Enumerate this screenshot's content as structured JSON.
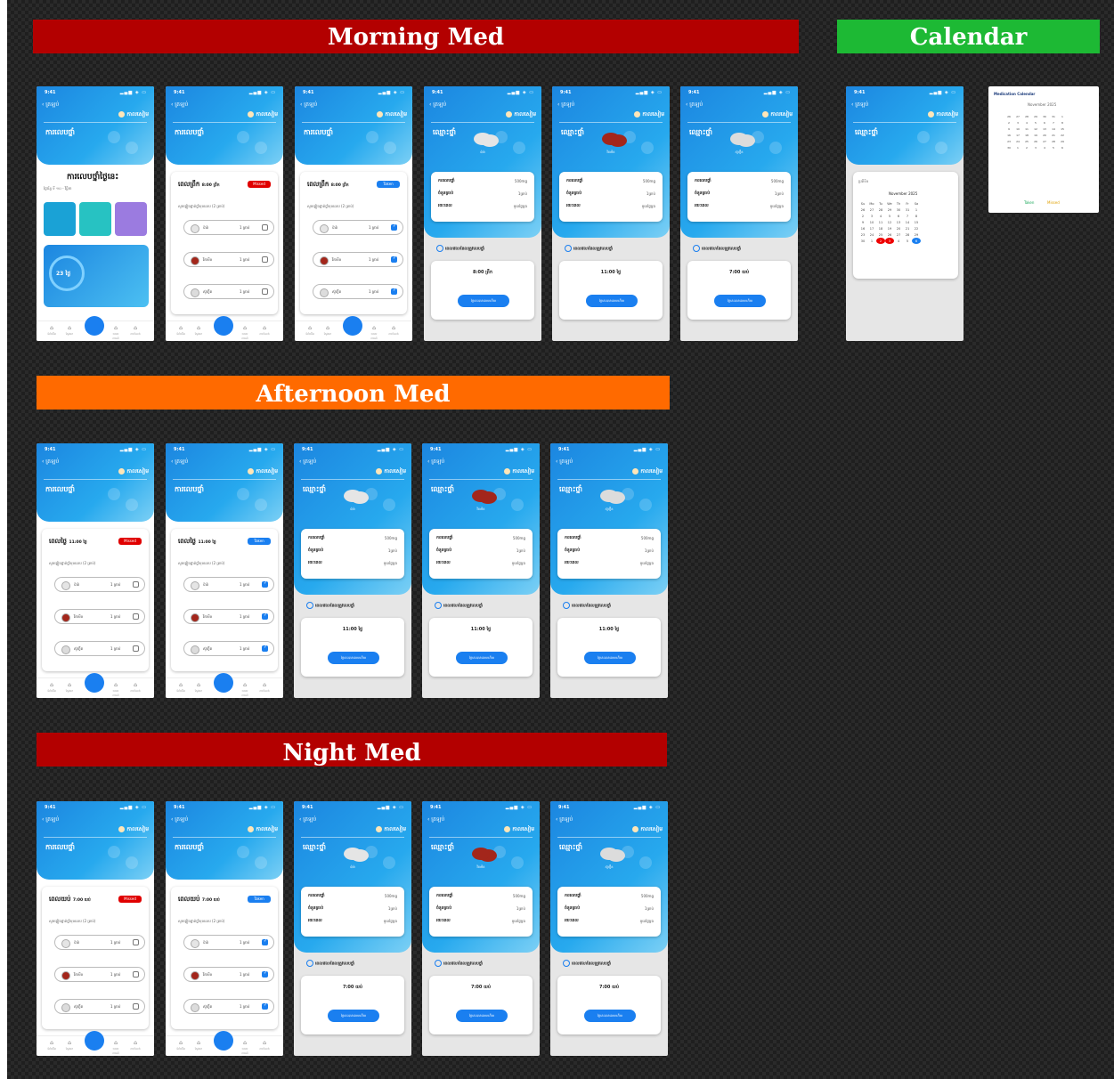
{
  "sections": {
    "morning": "Morning Med",
    "afternoon": "Afternoon Med",
    "night": "Night Med",
    "calendar": "Calendar"
  },
  "colors": {
    "morning": "#b30000",
    "afternoon": "#ff6a00",
    "night": "#b30000",
    "calendar": "#1db934",
    "accent": "#1a7ff0"
  },
  "phone": {
    "time": "9:41",
    "signal": "▂▄▆ ◈ ▭",
    "back": "‹ ត្រឡប់",
    "user": "កាលសៀម",
    "title_list": "ការលេបថ្នាំ",
    "title_detail": "ឈ្មោះថ្នាំ"
  },
  "morning": {
    "home_title": "ការលេបថ្នាំថ្ងៃនេះ",
    "home_sub": "ថ្ងៃច័ន្ទ ទី ១០ - វិច្ឆិកា",
    "ring_value": "23 ថ្ងៃ",
    "list_title": "ពេលព្រឹក",
    "list_time": "8:00 ព្រឹក",
    "badge_missed": "Missed",
    "badge_taken": "Taken",
    "instruction": "សូមផ្ទៀងផ្ទាត់ថ្នាំមុនលេប (2 គ្រាប់)",
    "time_text": "8:00 ព្រឹក"
  },
  "afternoon": {
    "list_title": "ពេលថ្ងៃ",
    "list_time": "11:00 ថ្ងៃ",
    "time_text": "11:00 ថ្ងៃ"
  },
  "night": {
    "list_title": "ពេលយប់",
    "list_time": "7:00 យប់",
    "time_text": "7:00 យប់"
  },
  "pills": [
    {
      "name": "ប៉ារ៉ា",
      "qty": "1 គ្រាប់",
      "color": "#e5e5e5"
    },
    {
      "name": "វីតាមីន",
      "qty": "1 គ្រាប់",
      "color": "#a3261b"
    },
    {
      "name": "ស៊ូហ្វ៊ីត",
      "qty": "1 គ្រាប់",
      "color": "#dcdcdc"
    }
  ],
  "detail": {
    "row1": "ការលេបថ្នាំ",
    "row2": "ចំនួនគ្រាប់",
    "row3": "រយៈពេល",
    "val1": "500mg",
    "val2": "1គ្រាប់",
    "val3": "មួយថ្ងៃម្តង",
    "sched_label": "ពេលវេលាដែលត្រូវលេបថ្នាំ",
    "button": "ថ្ងៃនេះបានលេបហើយ"
  },
  "calendar_ui": {
    "section_label": "ប្រតិទិន",
    "month": "November 2025",
    "widget_title": "Medication Calendar",
    "legend_taken": "Taken",
    "legend_missed": "Missed",
    "weekdays": [
      "Su",
      "Mo",
      "Tu",
      "We",
      "Th",
      "Fr",
      "Sa"
    ],
    "weeks": [
      [
        "26",
        "27",
        "28",
        "29",
        "30",
        "31",
        "1"
      ],
      [
        "2",
        "3",
        "4",
        "5",
        "6",
        "7",
        "8"
      ],
      [
        "9",
        "10",
        "11",
        "12",
        "13",
        "14",
        "15"
      ],
      [
        "16",
        "17",
        "18",
        "19",
        "20",
        "21",
        "22"
      ],
      [
        "23",
        "24",
        "25",
        "26",
        "27",
        "28",
        "29"
      ],
      [
        "30",
        "1",
        "2",
        "3",
        "4",
        "5",
        "6"
      ]
    ]
  },
  "nav": [
    "ទំព័រដើម",
    "ស្វែងរក",
    "ថ្នាំ",
    "របាយការណ៍",
    "ការកំណត់"
  ]
}
